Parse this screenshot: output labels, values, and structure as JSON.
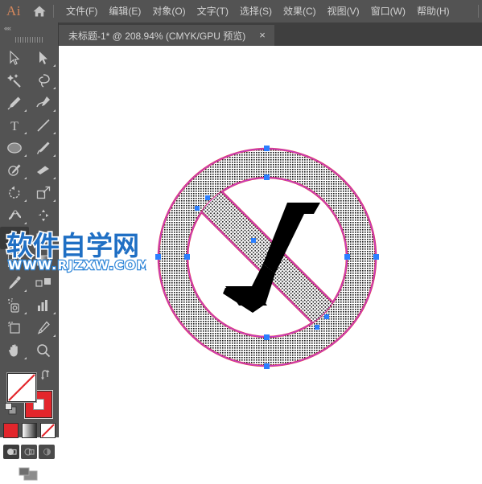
{
  "app": {
    "logo": "Ai",
    "home_icon": "home-icon"
  },
  "menu": {
    "items": [
      {
        "label": "文件(F)"
      },
      {
        "label": "编辑(E)"
      },
      {
        "label": "对象(O)"
      },
      {
        "label": "文字(T)"
      },
      {
        "label": "选择(S)"
      },
      {
        "label": "效果(C)"
      },
      {
        "label": "视图(V)"
      },
      {
        "label": "窗口(W)"
      },
      {
        "label": "帮助(H)"
      }
    ]
  },
  "tab": {
    "title": "未标题-1* @ 208.94% (CMYK/GPU 预览)",
    "close": "×"
  },
  "toolbar": {
    "collapse": "««",
    "grip": "toolbar-grip",
    "tools": [
      {
        "name": "selection-tool",
        "has_submenu": false
      },
      {
        "name": "direct-selection-tool",
        "has_submenu": true
      },
      {
        "name": "magic-wand-tool",
        "has_submenu": false
      },
      {
        "name": "lasso-tool",
        "has_submenu": false
      },
      {
        "name": "pen-tool",
        "has_submenu": true
      },
      {
        "name": "curvature-tool",
        "has_submenu": false
      },
      {
        "name": "type-tool",
        "has_submenu": true
      },
      {
        "name": "line-segment-tool",
        "has_submenu": true
      },
      {
        "name": "ellipse-tool",
        "has_submenu": true
      },
      {
        "name": "paintbrush-tool",
        "has_submenu": true
      },
      {
        "name": "shaper-tool",
        "has_submenu": true
      },
      {
        "name": "eraser-tool",
        "has_submenu": true
      },
      {
        "name": "rotate-tool",
        "has_submenu": true
      },
      {
        "name": "scale-tool",
        "has_submenu": true
      },
      {
        "name": "width-tool",
        "has_submenu": true
      },
      {
        "name": "free-transform-tool",
        "has_submenu": false
      },
      {
        "name": "shape-builder-tool",
        "has_submenu": true
      },
      {
        "name": "perspective-grid-tool",
        "has_submenu": true
      },
      {
        "name": "mesh-tool",
        "has_submenu": false
      },
      {
        "name": "gradient-tool",
        "has_submenu": false
      },
      {
        "name": "eyedropper-tool",
        "has_submenu": true
      },
      {
        "name": "blend-tool",
        "has_submenu": false
      },
      {
        "name": "symbol-sprayer-tool",
        "has_submenu": true
      },
      {
        "name": "column-graph-tool",
        "has_submenu": true
      },
      {
        "name": "artboard-tool",
        "has_submenu": false
      },
      {
        "name": "slice-tool",
        "has_submenu": true
      },
      {
        "name": "hand-tool",
        "has_submenu": true
      },
      {
        "name": "zoom-tool",
        "has_submenu": false
      }
    ],
    "active_tool": "shape-builder-tool",
    "colors": {
      "fill": "none",
      "fill_color": "#ffffff",
      "stroke_color": "#e3262c",
      "slash_color": "#e3262c"
    },
    "mini_swatches": [
      {
        "name": "color-swatch"
      },
      {
        "name": "gradient-swatch"
      },
      {
        "name": "none-swatch",
        "selected": true
      }
    ],
    "draw_modes": [
      {
        "name": "draw-normal",
        "selected": true
      },
      {
        "name": "draw-behind",
        "selected": false
      },
      {
        "name": "draw-inside",
        "selected": false
      }
    ],
    "screen_mode": "change-screen-mode"
  },
  "artwork": {
    "name": "no-shovel-prohibition-sign",
    "stroke_color": "#c23cc8",
    "outer_stroke_color": "#e8394a",
    "shovel_color": "#000000",
    "pattern_fill": "dot-pattern",
    "anchor_color": "#2b7fff"
  },
  "watermark": {
    "title": "软件自学网",
    "url": "WWW.RJZXW.COM",
    "color": "#1f6fc4"
  }
}
